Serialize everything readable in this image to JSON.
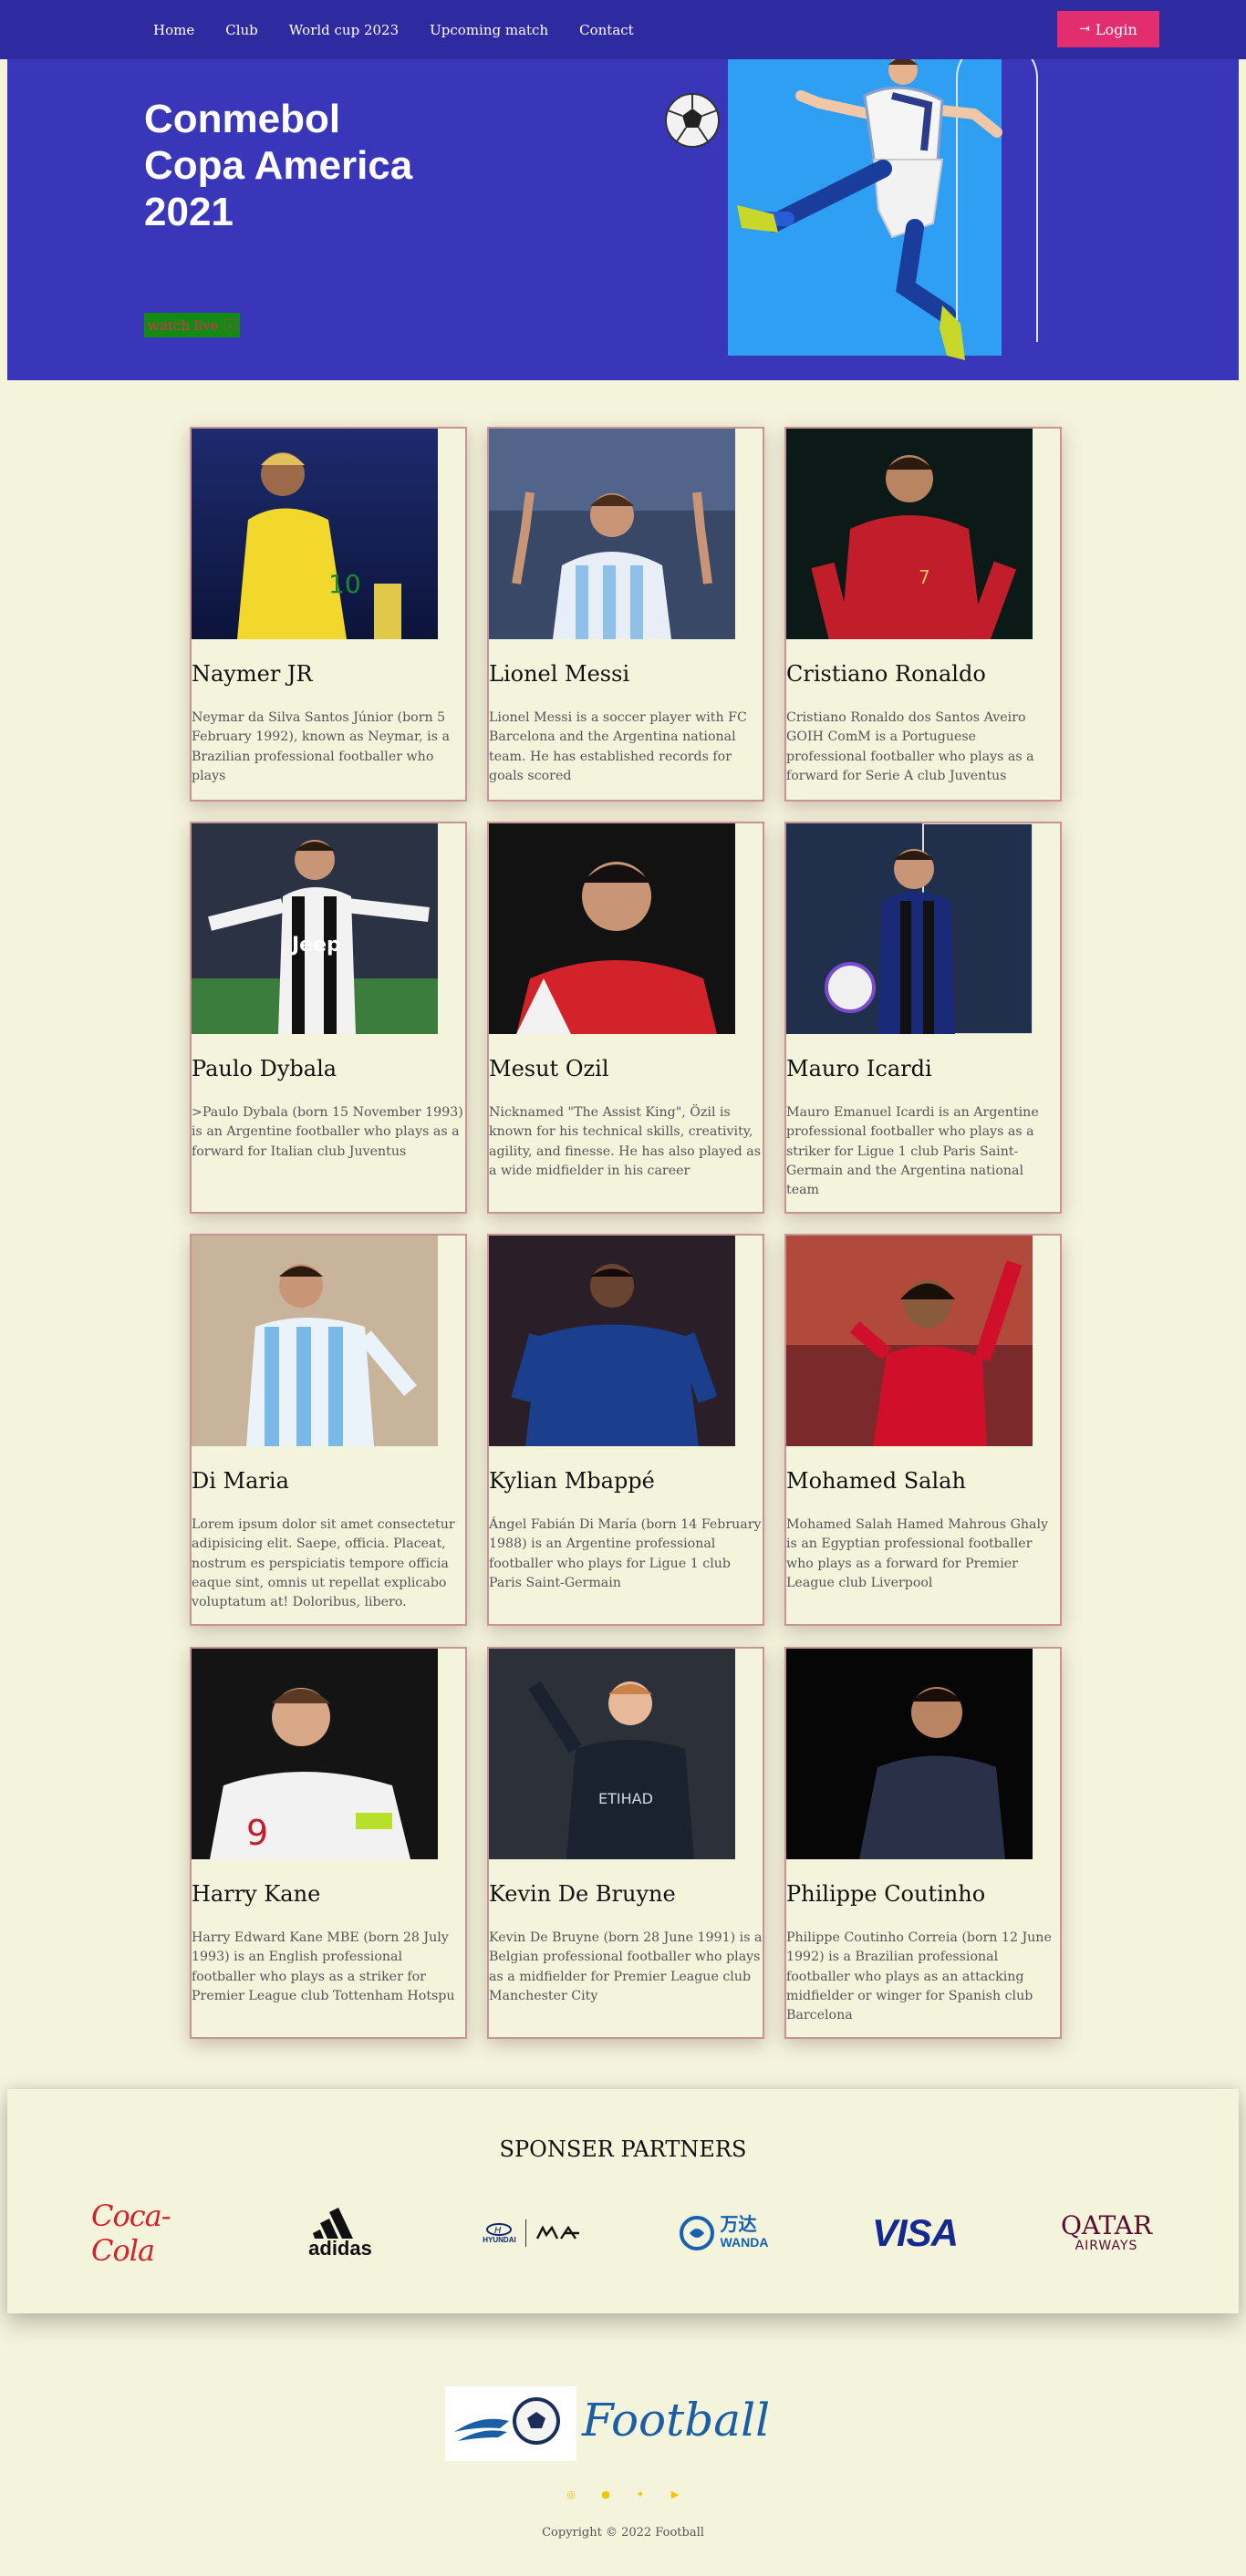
{
  "nav": {
    "links": [
      "Home",
      "Club",
      "World cup 2023",
      "Upcoming match",
      "Contact"
    ],
    "login_label": "Login",
    "login_icon": "login-arrow-icon"
  },
  "hero": {
    "title": "Conmebol Copa America 2021",
    "watch_label": "watch live"
  },
  "players": [
    {
      "name": "Naymer JR",
      "desc": "Neymar da Silva Santos Júnior (born 5 February 1992), known as Neymar, is a Brazilian professional footballer who plays"
    },
    {
      "name": "Lionel Messi",
      "desc": "Lionel Messi is a soccer player with FC Barcelona and the Argentina national team. He has established records for goals scored"
    },
    {
      "name": "Cristiano Ronaldo",
      "desc": "Cristiano Ronaldo dos Santos Aveiro GOIH ComM is a Portuguese professional footballer who plays as a forward for Serie A club Juventus"
    },
    {
      "name": "Paulo Dybala",
      "desc": ">Paulo Dybala (born 15 November 1993) is an Argentine footballer who plays as a forward for Italian club Juventus"
    },
    {
      "name": "Mesut Ozil",
      "desc": "Nicknamed \"The Assist King\", Özil is known for his technical skills, creativity, agility, and finesse. He has also played as a wide midfielder in his career"
    },
    {
      "name": "Mauro Icardi",
      "desc": "Mauro Emanuel Icardi is an Argentine professional footballer who plays as a striker for Ligue 1 club Paris Saint-Germain and the Argentina national team"
    },
    {
      "name": "Di Maria",
      "desc": "Lorem ipsum dolor sit amet consectetur adipisicing elit. Saepe, officia. Placeat, nostrum es perspiciatis tempore officia eaque sint, omnis ut repellat explicabo voluptatum at! Doloribus, libero."
    },
    {
      "name": "Kylian Mbappé",
      "desc": "Ángel Fabián Di María (born 14 February 1988) is an Argentine professional footballer who plays for Ligue 1 club Paris Saint-Germain"
    },
    {
      "name": "Mohamed Salah",
      "desc": "Mohamed Salah Hamed Mahrous Ghaly is an Egyptian professional footballer who plays as a forward for Premier League club Liverpool"
    },
    {
      "name": "Harry Kane",
      "desc": "Harry Edward Kane MBE (born 28 July 1993) is an English professional footballer who plays as a striker for Premier League club Tottenham Hotspu"
    },
    {
      "name": "Kevin De Bruyne",
      "desc": "Kevin De Bruyne (born 28 June 1991) is a Belgian professional footballer who plays as a midfielder for Premier League club Manchester City"
    },
    {
      "name": "Philippe Coutinho",
      "desc": "Philippe Coutinho Correia (born 12 June 1992) is a Brazilian professional footballer who plays as an attacking midfielder or winger for Spanish club Barcelona"
    }
  ],
  "sponsors": {
    "title": "SPONSER PARTNERS",
    "logos": [
      "Coca-Cola",
      "adidas",
      "HYUNDAI",
      "万达",
      "WANDA",
      "VISA",
      "QATAR",
      "AIRWAYS"
    ]
  },
  "footer": {
    "brand": "Football",
    "social_icons": [
      "instagram-icon",
      "pinterest-icon",
      "twitter-icon",
      "youtube-icon"
    ],
    "copyright": "Copyright © 2022 Football"
  }
}
